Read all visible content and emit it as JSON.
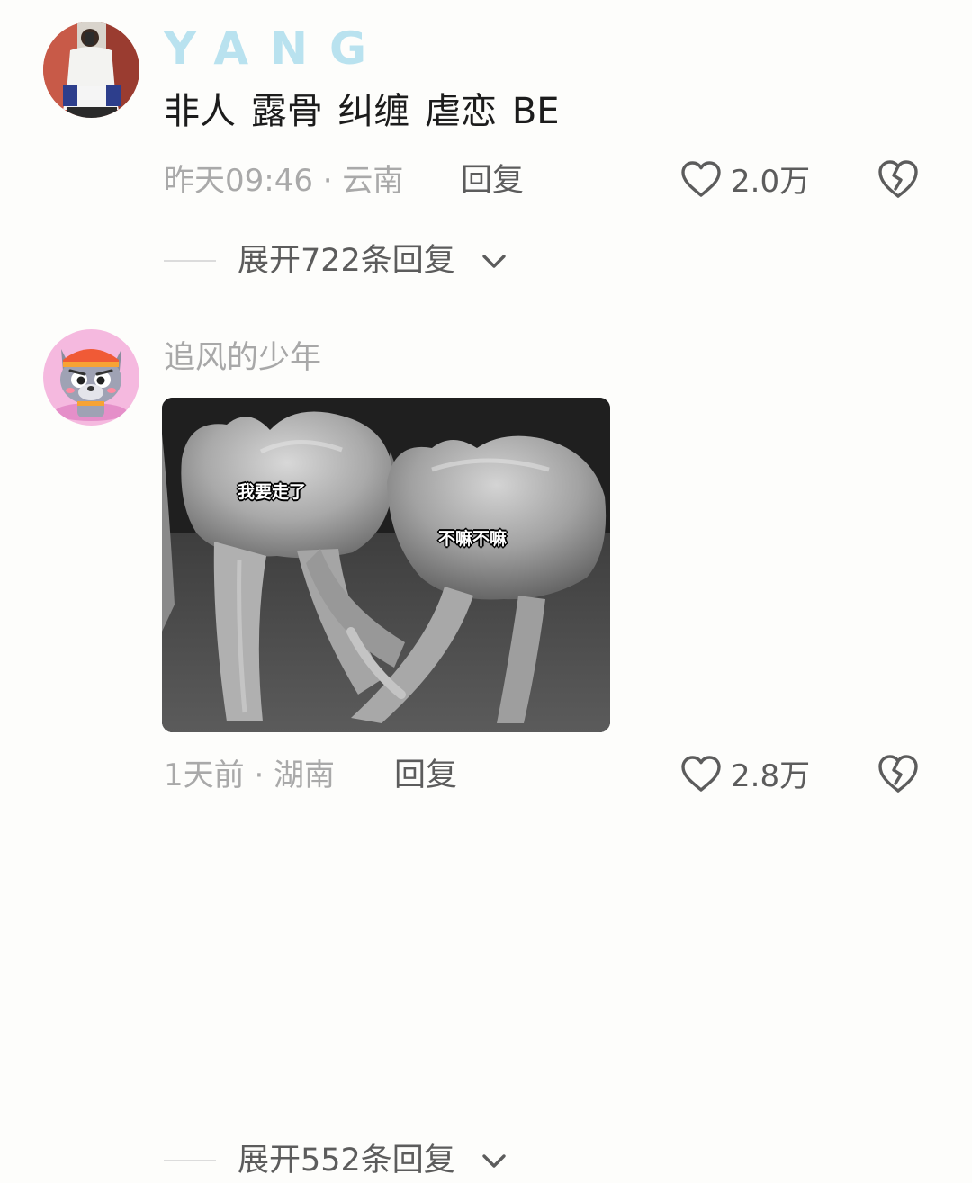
{
  "comments": [
    {
      "username": "YANG",
      "text": "非人 露骨 纠缠 虐恋 BE",
      "time_location": "昨天09:46 · 云南",
      "reply_label": "回复",
      "like_count": "2.0万",
      "expand_label": "展开722条回复"
    },
    {
      "username": "追风的少年",
      "image_labels": [
        "我要走了",
        "不嘛不嘛"
      ],
      "time_location": "1天前 · 湖南",
      "reply_label": "回复",
      "like_count": "2.8万",
      "expand_label": "展开552条回复"
    }
  ],
  "icons": {
    "like": "heart-outline-icon",
    "dislike": "broken-heart-icon",
    "expand": "chevron-down-icon"
  },
  "colors": {
    "username_highlight": "#b9e2ef",
    "meta_text": "#a9a9a9",
    "body_text": "#1c1c1c",
    "action_text": "#5c5c5c"
  }
}
